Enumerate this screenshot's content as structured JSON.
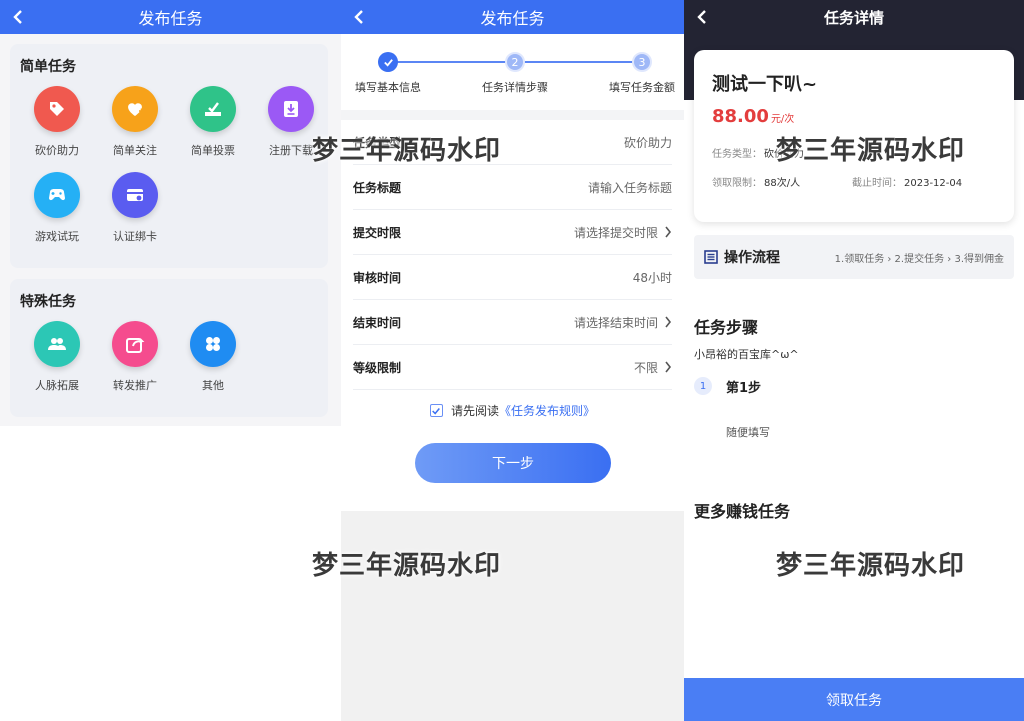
{
  "panel1": {
    "title": "发布任务",
    "simple": {
      "title": "简单任务",
      "items": [
        {
          "label": "砍价助力",
          "icon": "tag-icon",
          "color": "#f0594f"
        },
        {
          "label": "简单关注",
          "icon": "heart-plus-icon",
          "color": "#f7a21a"
        },
        {
          "label": "简单投票",
          "icon": "vote-icon",
          "color": "#2fc389"
        },
        {
          "label": "注册下载",
          "icon": "download-icon",
          "color": "#9b59f5"
        },
        {
          "label": "游戏试玩",
          "icon": "gamepad-icon",
          "color": "#25b0f5"
        },
        {
          "label": "认证绑卡",
          "icon": "card-link-icon",
          "color": "#5a5cf0"
        }
      ]
    },
    "special": {
      "title": "特殊任务",
      "items": [
        {
          "label": "人脉拓展",
          "icon": "people-icon",
          "color": "#2cc7b5"
        },
        {
          "label": "转发推广",
          "icon": "share-icon",
          "color": "#f54c8e"
        },
        {
          "label": "其他",
          "icon": "clover-icon",
          "color": "#1f8cf2"
        }
      ]
    }
  },
  "panel2": {
    "title": "发布任务",
    "steps": [
      {
        "num": "✓",
        "label": "填写基本信息"
      },
      {
        "num": "2",
        "label": "任务详情步骤"
      },
      {
        "num": "3",
        "label": "填写任务金额"
      }
    ],
    "rows": [
      {
        "label": "任务类型",
        "value": "砍价助力",
        "chevron": false
      },
      {
        "label": "任务标题",
        "value": "请输入任务标题",
        "chevron": false
      },
      {
        "label": "提交时限",
        "value": "请选择提交时限",
        "chevron": true
      },
      {
        "label": "审核时间",
        "value": "48小时",
        "chevron": false
      },
      {
        "label": "结束时间",
        "value": "请选择结束时间",
        "chevron": true
      },
      {
        "label": "等级限制",
        "value": "不限",
        "chevron": true
      }
    ],
    "agree_prefix": "请先阅读",
    "agree_link": "《任务发布规则》",
    "next": "下一步"
  },
  "panel3": {
    "title": "任务详情",
    "task_title": "测试一下叭~",
    "price": "88.00",
    "price_unit": "元/次",
    "type_label": "任务类型：",
    "type_value": "砍价助力",
    "limit_label": "领取限制：",
    "limit_value": "88次/人",
    "deadline_label": "截止时间：",
    "deadline_value": "2023-12-04",
    "flow_title": "操作流程",
    "flow_steps": "1.领取任务 › 2.提交任务 › 3.得到佣金",
    "steps_title": "任务步骤",
    "author": "小昂裕的百宝库^ω^",
    "step_num": "1",
    "step_name": "第1步",
    "step_desc": "随便填写",
    "more_title": "更多赚钱任务",
    "claim": "领取任务"
  },
  "watermark": "梦三年源码水印"
}
